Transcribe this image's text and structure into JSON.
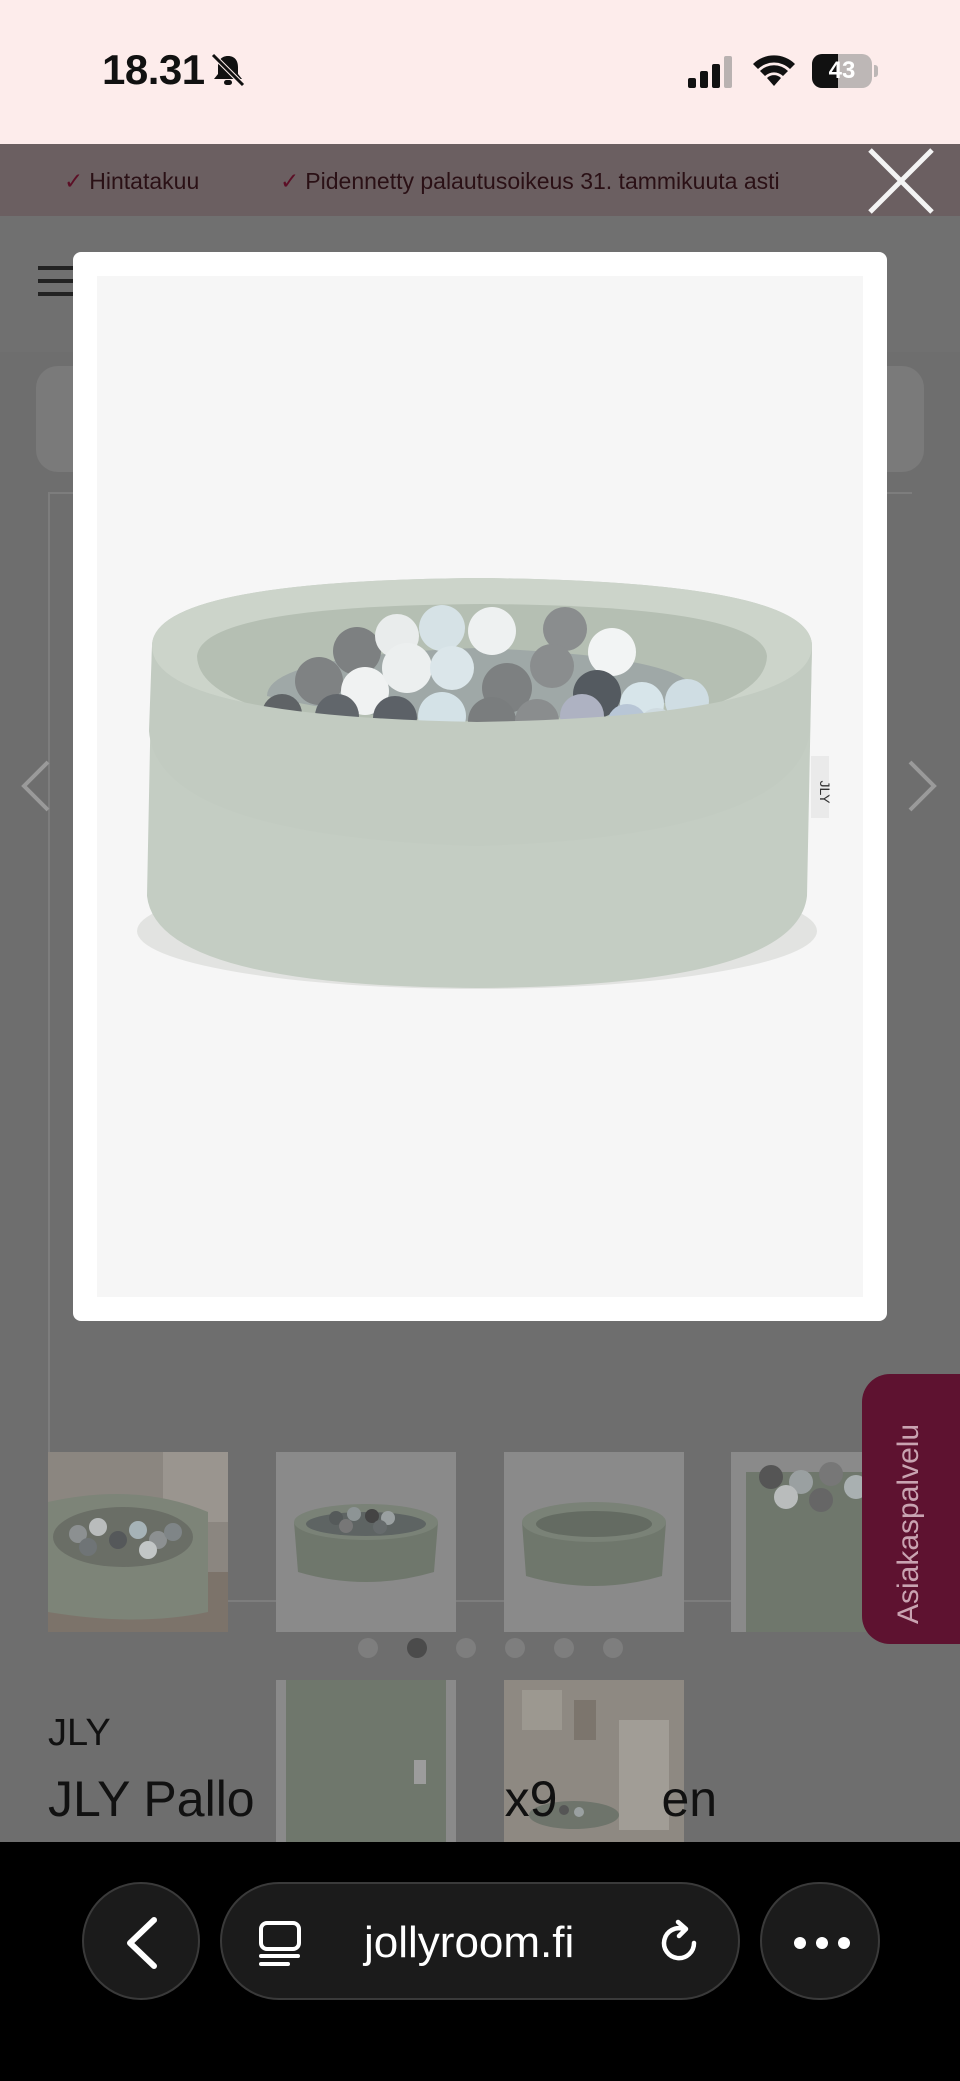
{
  "status_bar": {
    "time": "18.31",
    "battery": "43",
    "battery_level": 0.43,
    "icons": [
      "bell-slash-icon",
      "cellular-signal-icon",
      "wifi-icon",
      "battery-icon"
    ]
  },
  "promo_bar": {
    "items": [
      "Hintatakuu",
      "Pidennetty palautusoikeus 31. tammikuuta asti"
    ]
  },
  "gallery": {
    "dots_count": 6,
    "active_dot": 1
  },
  "chat_tab": {
    "label": "Asiakaspalvelu"
  },
  "product": {
    "brand": "JLY",
    "title_parts": [
      "JLY Pallo",
      "x9",
      "en"
    ]
  },
  "browser": {
    "url": "jollyroom.fi"
  },
  "colors": {
    "status_bg": "#fdeceb",
    "overlay": "#6e6e6e",
    "brand_accent": "#5e1230",
    "ballpit_green": "#c4cdc3"
  }
}
